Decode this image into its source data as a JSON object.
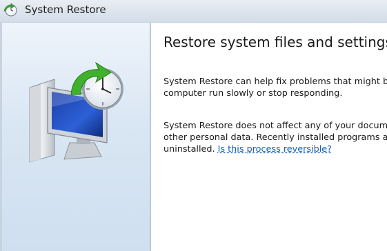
{
  "window": {
    "title": "System Restore",
    "icon": "system-restore-icon"
  },
  "sidebar": {
    "illustration": "system-restore-clock-monitor-icon"
  },
  "content": {
    "heading": "Restore system files and settings",
    "paragraph1": {
      "line1": "System Restore can help fix problems that might be",
      "line2": "computer run slowly or stop responding."
    },
    "paragraph2": {
      "line1": "System Restore does not affect any of your docume",
      "line2": "other personal data. Recently installed programs an",
      "line3_prefix": "uninstalled. ",
      "link": "Is this process reversible?"
    }
  },
  "colors": {
    "link": "#0a5fc2",
    "sidebar": "#d9e6f3",
    "titlebar": "#dce4ed"
  }
}
